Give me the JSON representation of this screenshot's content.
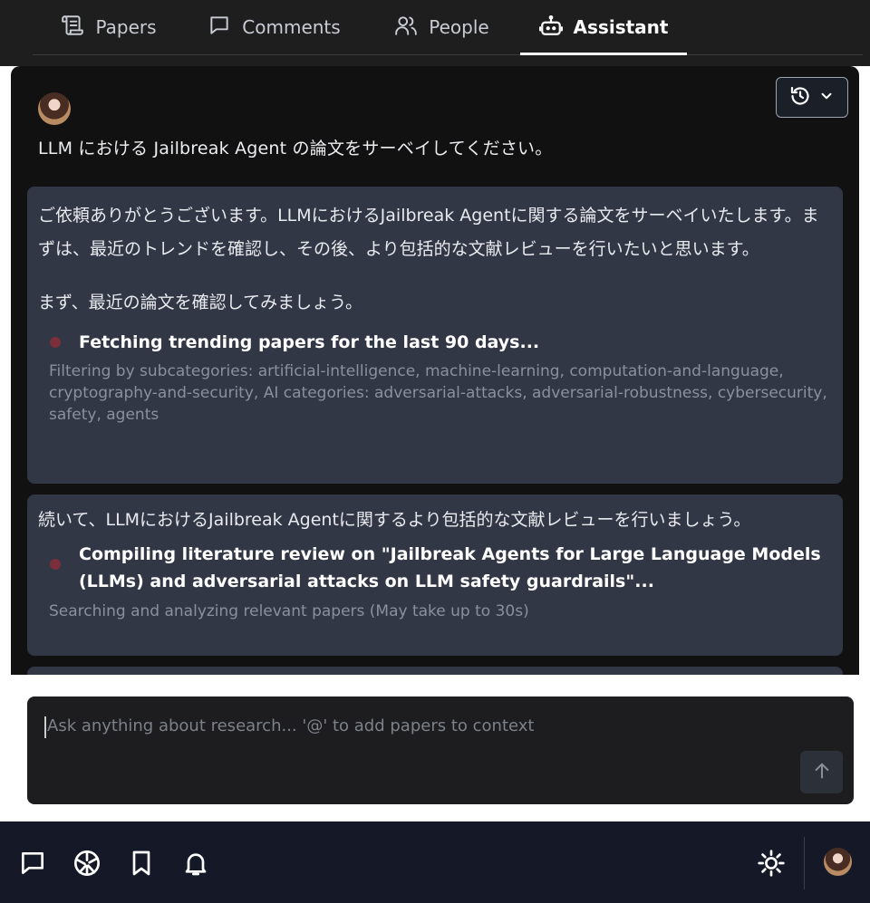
{
  "tabs": [
    {
      "label": "Papers",
      "icon": "scroll-icon",
      "active": false
    },
    {
      "label": "Comments",
      "icon": "comment-icon",
      "active": false
    },
    {
      "label": "People",
      "icon": "people-icon",
      "active": false
    },
    {
      "label": "Assistant",
      "icon": "bot-icon",
      "active": true
    }
  ],
  "conversation": {
    "user_message": "LLM における Jailbreak Agent の論文をサーベイしてください。",
    "assistant_messages": [
      {
        "text_1": "ご依頼ありがとうございます。LLMにおけるJailbreak Agentに関する論文をサーベイいたします。まずは、最近のトレンドを確認し、その後、より包括的な文献レビューを行いたいと思います。",
        "text_2": "まず、最近の論文を確認してみましょう。",
        "tool": {
          "title": "Fetching trending papers for the last 90 days...",
          "detail": "Filtering by subcategories: artificial-intelligence, machine-learning, computation-and-language, cryptography-and-security, AI categories: adversarial-attacks, adversarial-robustness, cybersecurity, safety, agents"
        }
      },
      {
        "text_1": "続いて、LLMにおけるJailbreak Agentに関するより包括的な文献レビューを行いましょう。",
        "tool": {
          "title": "Compiling literature review on \"Jailbreak Agents for Large Language Models (LLMs) and adversarial attacks on LLM safety guardrails\"...",
          "detail": "Searching and analyzing relevant papers (May take up to 30s)"
        }
      }
    ]
  },
  "input": {
    "placeholder": "Ask anything about research... '@' to add papers to context",
    "value": ""
  },
  "footer_icons": [
    "chat-icon",
    "explore-icon",
    "bookmark-icon",
    "bell-icon",
    "sun-icon"
  ],
  "colors": {
    "panel_bg": "#111112",
    "card_bg": "#323746",
    "footer_bg": "#141827",
    "tool_dot": "#7a2f3a"
  }
}
